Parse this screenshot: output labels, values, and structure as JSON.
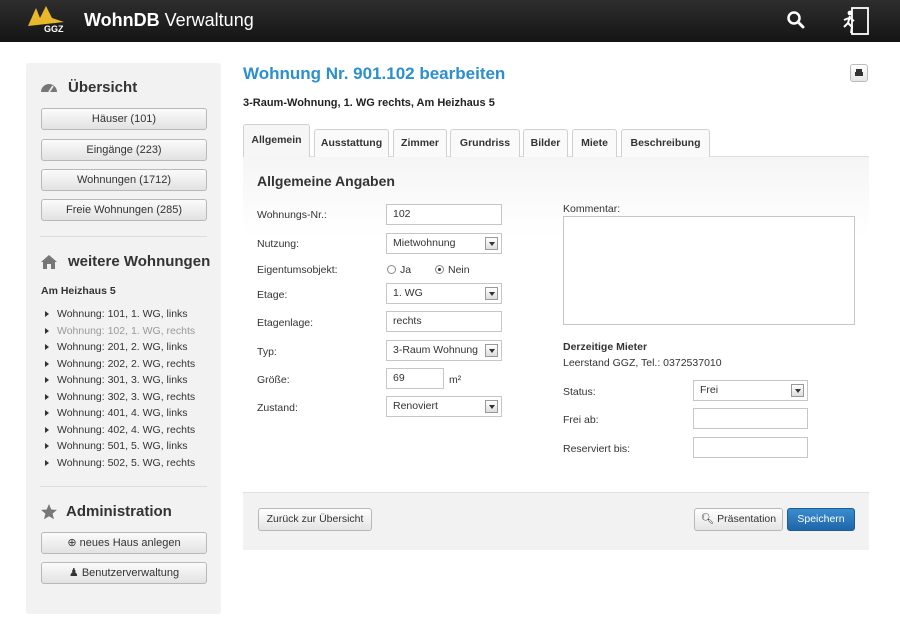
{
  "header": {
    "logo_text": "GGZ",
    "brand_bold": "WohnDB",
    "brand_rest": " Verwaltung",
    "search_icon": "search-icon",
    "logout_icon": "exit-icon"
  },
  "sidebar": {
    "overview_title": "Übersicht",
    "overview_buttons": [
      "Häuser (101)",
      "Eingänge (223)",
      "Wohnungen (1712)",
      "Freie Wohnungen (285)"
    ],
    "more_title": "weitere Wohnungen",
    "street": "Am Heizhaus 5",
    "apartments": [
      "Wohnung: 101, 1. WG, links",
      "Wohnung: 102, 1. WG, rechts",
      "Wohnung: 201, 2. WG, links",
      "Wohnung: 202, 2. WG, rechts",
      "Wohnung: 301, 3. WG, links",
      "Wohnung: 302, 3. WG, rechts",
      "Wohnung: 401, 4. WG, links",
      "Wohnung: 402, 4. WG, rechts",
      "Wohnung: 501, 5. WG, links",
      "Wohnung: 502, 5. WG, rechts"
    ],
    "admin_title": "Administration",
    "new_house": "neues Haus anlegen",
    "user_admin": "Benutzerverwaltung"
  },
  "page": {
    "title": "Wohnung Nr. 901.102 bearbeiten",
    "subtitle": "3-Raum-Wohnung, 1. WG rechts, Am Heizhaus 5"
  },
  "tabs": [
    "Allgemein",
    "Ausstattung",
    "Zimmer",
    "Grundriss",
    "Bilder",
    "Miete",
    "Beschreibung"
  ],
  "form": {
    "section_title": "Allgemeine Angaben",
    "nr_label": "Wohnungs-Nr.:",
    "nr_value": "102",
    "nutzung_label": "Nutzung:",
    "nutzung_value": "Mietwohnung",
    "eigentum_label": "Eigentumsobjekt:",
    "eigentum_ja": "Ja",
    "eigentum_nein": "Nein",
    "etage_label": "Etage:",
    "etage_value": "1. WG",
    "etagenlage_label": "Etagenlage:",
    "etagenlage_value": "rechts",
    "typ_label": "Typ:",
    "typ_value": "3-Raum Wohnung",
    "groesse_label": "Größe:",
    "groesse_value": "69",
    "groesse_unit": "m²",
    "zustand_label": "Zustand:",
    "zustand_value": "Renoviert",
    "kommentar_label": "Kommentar:",
    "mieter_title": "Derzeitige Mieter",
    "mieter_value": "Leerstand GGZ, Tel.: 0372537010",
    "status_label": "Status:",
    "status_value": "Frei",
    "freiab_label": "Frei ab:",
    "reserviert_label": "Reserviert bis:"
  },
  "footer": {
    "back": "Zurück zur Übersicht",
    "presentation": "Präsentation",
    "save": "Speichern"
  }
}
